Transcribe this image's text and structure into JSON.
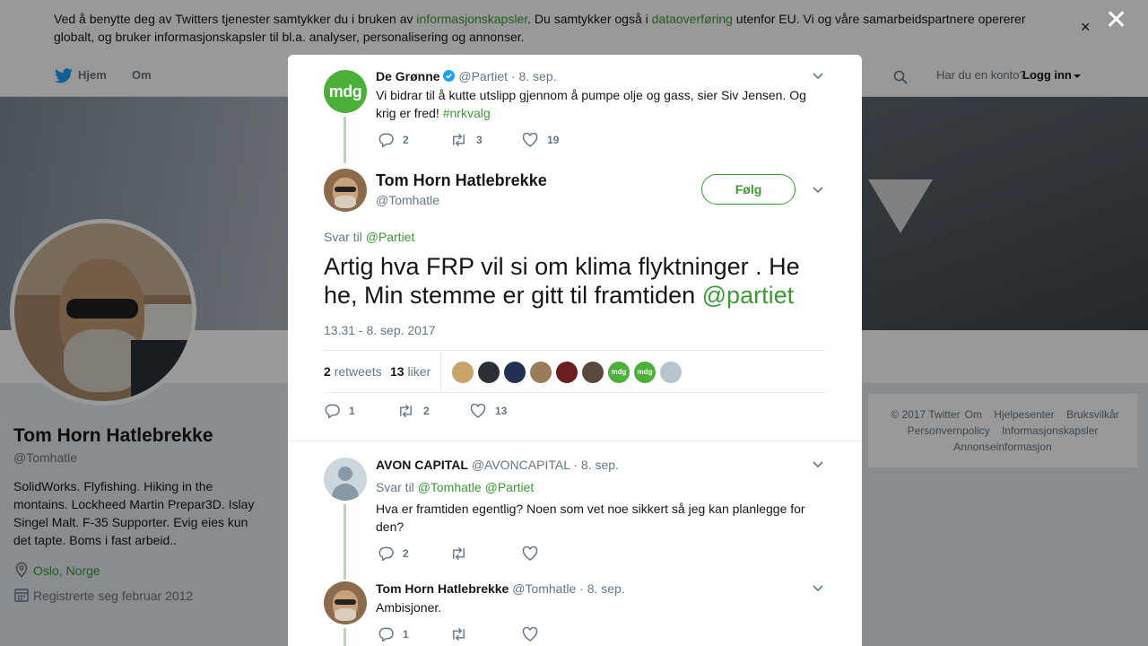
{
  "cookie": {
    "t1": "Ved å benytte deg av Twitters tjenester samtykker du i bruken av ",
    "link1": "informasjonskapsler",
    "t2": ". Du samtykker også i ",
    "link2": "dataoverføring",
    "t3": " utenfor EU. Vi og våre samarbeidspartnere opererer globalt, og bruker informasjonskapsler til bl.a. analyser, personalisering og annonser.",
    "close": "×"
  },
  "overlay_close": "✕",
  "nav": {
    "home": "Hjem",
    "about": "Om",
    "account_prompt": "Har du en konto?",
    "login": "Logg inn"
  },
  "profile": {
    "name": "Tom Horn Hatlebrekke",
    "handle": "@Tomhatle",
    "bio": "SolidWorks. Flyfishing. Hiking in the montains. Lockheed Martin Prepar3D. Islay Singel Malt. F-35 Supporter. Evig eies kun det tapte. Boms i fast arbeid..",
    "location": "Oslo, Norge",
    "joined": "Registrerte seg februar 2012"
  },
  "footer": {
    "copyright": "© 2017 Twitter",
    "about": "Om",
    "help": "Hjelpesenter",
    "terms": "Bruksvilkår",
    "privacy": "Personvernpolicy",
    "cookies": "Informasjonskapsler",
    "ads": "Annonseinformasjon"
  },
  "parent_tweet": {
    "avatar_text": "mdg",
    "name": "De Grønne",
    "handle": "@Partiet",
    "date": "· 8. sep.",
    "text": "Vi bidrar til å kutte utslipp gjennom å pumpe olje og gass, sier Siv Jensen. Og krig er fred! ",
    "hashtag": "#nrkvalg",
    "replies": "2",
    "retweets": "3",
    "likes": "19"
  },
  "main_tweet": {
    "name": "Tom Horn Hatlebrekke",
    "handle": "@Tomhatle",
    "follow": "Følg",
    "reply_label": "Svar til ",
    "reply_to": "@Partiet",
    "text": "Artig hva FRP vil si om klima flyktninger . He he, Min stemme er gitt til framtiden ",
    "mention": "@partiet",
    "timestamp": "13.31 - 8. sep. 2017",
    "retweet_count": "2",
    "retweet_label": "retweets",
    "like_count": "13",
    "like_label": "liker",
    "liker_avatars": [
      {
        "color": "#c8a46a",
        "text": ""
      },
      {
        "color": "#2c3035",
        "text": ""
      },
      {
        "color": "#233052",
        "text": ""
      },
      {
        "color": "#9a7b5a",
        "text": ""
      },
      {
        "color": "#6b1e22",
        "text": ""
      },
      {
        "color": "#5b4a3c",
        "text": ""
      },
      {
        "color": "#4caf3a",
        "text": "mdg"
      },
      {
        "color": "#4caf3a",
        "text": "mdg"
      },
      {
        "color": "#b8c4cc",
        "text": ""
      }
    ],
    "replies": "1",
    "retweets": "2",
    "likes": "13"
  },
  "replies": [
    {
      "name": "AVON CAPITAL",
      "handle": "@AVONCAPITAL",
      "date": "· 8. sep.",
      "reply_label": "Svar til ",
      "reply_to_1": "@Tomhatle",
      "reply_to_2": "@Partiet",
      "text": "Hva er framtiden egentlig? Noen som vet noe sikkert så jeg kan planlegge for den?",
      "replies": "2",
      "retweets": "",
      "likes": ""
    },
    {
      "name": "Tom Horn Hatlebrekke",
      "handle": "@Tomhatle",
      "date": "· 8. sep.",
      "text": "Ambisjoner.",
      "replies": "1",
      "retweets": "",
      "likes": ""
    }
  ],
  "colors": {
    "accent": "#3b9a36",
    "thread_line": "#b5d9b0",
    "muted": "#657786"
  },
  "icons": [
    "twitter-bird-icon",
    "search-icon",
    "close-icon",
    "verified-badge-icon",
    "reply-icon",
    "retweet-icon",
    "like-icon",
    "chevron-down-icon",
    "location-icon",
    "calendar-icon"
  ]
}
